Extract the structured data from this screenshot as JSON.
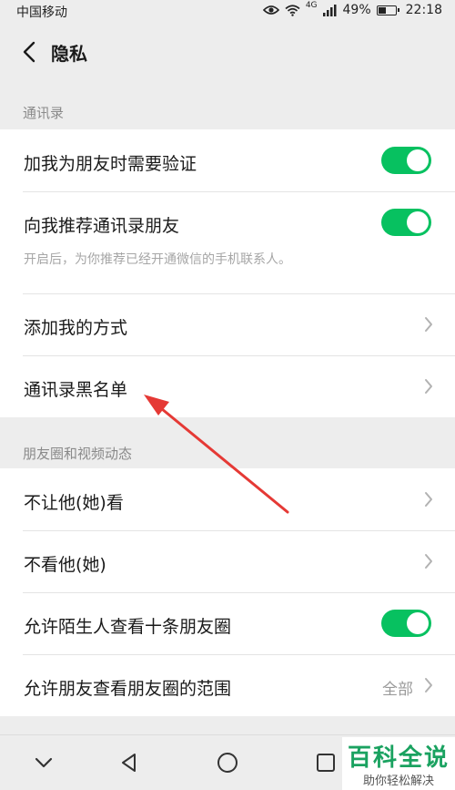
{
  "status_bar": {
    "carrier": "中国移动",
    "network": "4G",
    "battery": "49%",
    "battery_level": 0.49,
    "time": "22:18"
  },
  "nav": {
    "title": "隐私"
  },
  "sections": {
    "contacts": {
      "header": "通讯录",
      "rows": [
        {
          "label": "加我为朋友时需要验证",
          "toggle_on": true
        },
        {
          "label": "向我推荐通讯录朋友",
          "desc": "开启后，为你推荐已经开通微信的手机联系人。",
          "toggle_on": true
        },
        {
          "label": "添加我的方式"
        },
        {
          "label": "通讯录黑名单"
        }
      ]
    },
    "moments": {
      "header": "朋友圈和视频动态",
      "rows": [
        {
          "label": "不让他(她)看"
        },
        {
          "label": "不看他(她)"
        },
        {
          "label": "允许陌生人查看十条朋友圈",
          "toggle_on": true
        },
        {
          "label": "允许朋友查看朋友圈的范围",
          "value": "全部"
        }
      ]
    }
  },
  "watermark": {
    "main": "百科全说",
    "sub": "助你轻松解决"
  },
  "colors": {
    "accent_green": "#07c160",
    "annotation_red": "#e53935",
    "watermark_green": "#1aa260"
  }
}
